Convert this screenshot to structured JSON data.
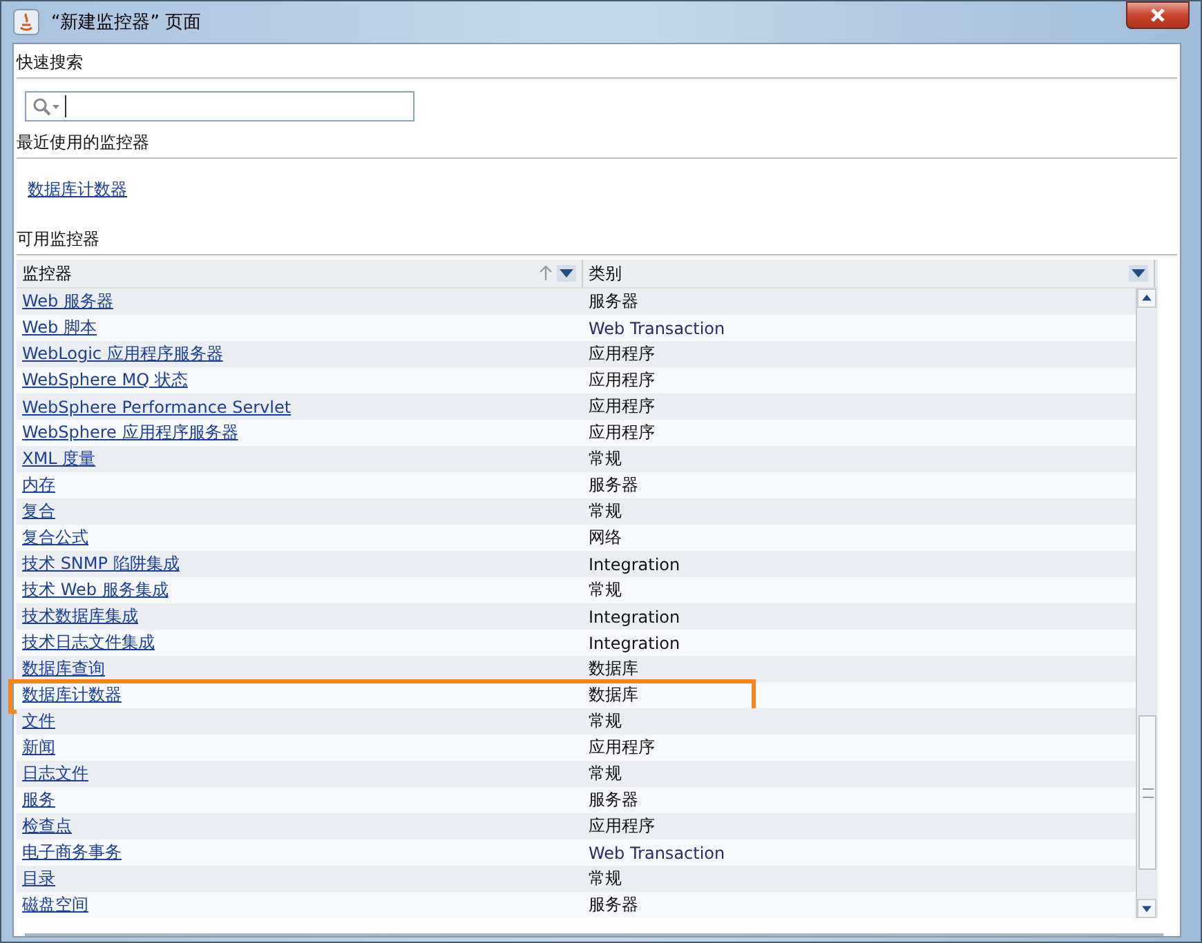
{
  "window": {
    "title": "“新建监控器” 页面"
  },
  "quick_search": {
    "heading": "快速搜索"
  },
  "recent": {
    "heading": "最近使用的监控器",
    "items": [
      "数据库计数器"
    ]
  },
  "available": {
    "heading": "可用监控器",
    "columns": [
      {
        "label": "监控器",
        "sorted": true
      },
      {
        "label": "类别",
        "sorted": false
      }
    ],
    "rows": [
      {
        "name": "Web 服务器",
        "category": "服务器",
        "highlighted": false
      },
      {
        "name": "Web 脚本",
        "category": "Web Transaction",
        "highlighted": false
      },
      {
        "name": "WebLogic 应用程序服务器",
        "category": "应用程序",
        "highlighted": false
      },
      {
        "name": "WebSphere MQ 状态",
        "category": "应用程序",
        "highlighted": false
      },
      {
        "name": "WebSphere Performance Servlet",
        "category": "应用程序",
        "highlighted": false
      },
      {
        "name": "WebSphere 应用程序服务器",
        "category": "应用程序",
        "highlighted": false
      },
      {
        "name": "XML 度量",
        "category": "常规",
        "highlighted": false
      },
      {
        "name": "内存",
        "category": "服务器",
        "highlighted": false
      },
      {
        "name": "复合",
        "category": "常规",
        "highlighted": false
      },
      {
        "name": "复合公式",
        "category": "网络",
        "highlighted": false
      },
      {
        "name": "技术 SNMP 陷阱集成",
        "category": "Integration",
        "highlighted": false
      },
      {
        "name": "技术 Web 服务集成",
        "category": "常规",
        "highlighted": false
      },
      {
        "name": "技术数据库集成",
        "category": "Integration",
        "highlighted": false
      },
      {
        "name": "技术日志文件集成",
        "category": "Integration",
        "highlighted": false
      },
      {
        "name": "数据库查询",
        "category": "数据库",
        "highlighted": false
      },
      {
        "name": "数据库计数器",
        "category": "数据库",
        "highlighted": true
      },
      {
        "name": "文件",
        "category": "常规",
        "highlighted": false
      },
      {
        "name": "新闻",
        "category": "应用程序",
        "highlighted": false
      },
      {
        "name": "日志文件",
        "category": "常规",
        "highlighted": false
      },
      {
        "name": "服务",
        "category": "服务器",
        "highlighted": false
      },
      {
        "name": "检查点",
        "category": "应用程序",
        "highlighted": false
      },
      {
        "name": "电子商务事务",
        "category": "Web Transaction",
        "highlighted": false
      },
      {
        "name": "目录",
        "category": "常规",
        "highlighted": false
      },
      {
        "name": "磁盘空间",
        "category": "服务器",
        "highlighted": false
      }
    ]
  }
}
